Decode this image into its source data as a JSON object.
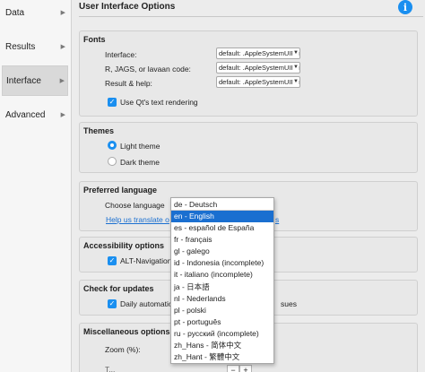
{
  "sidebar": {
    "items": [
      {
        "label": "Data"
      },
      {
        "label": "Results"
      },
      {
        "label": "Interface"
      },
      {
        "label": "Advanced"
      }
    ],
    "active_index": 2
  },
  "page": {
    "title": "User Interface Options",
    "info_icon": "info-icon"
  },
  "fonts": {
    "title": "Fonts",
    "interface_label": "Interface:",
    "interface_value": "default: .AppleSystemUIFont",
    "rjags_label": "R, JAGS, or lavaan code:",
    "rjags_value": "default: .AppleSystemUIFont",
    "result_label": "Result & help:",
    "result_value": "default: .AppleSystemUIFont",
    "qt_rendering_label": "Use Qt's text rendering",
    "qt_rendering_checked": true
  },
  "themes": {
    "title": "Themes",
    "light_label": "Light theme",
    "dark_label": "Dark theme",
    "selected": "light"
  },
  "language": {
    "title": "Preferred language",
    "choose_label": "Choose language",
    "help_link": "Help us translate o",
    "help_link_tail": "s",
    "current": "de - Deutsch",
    "options": [
      "en - English",
      "es - español de España",
      "fr - français",
      "gl - galego",
      "id - Indonesia (incomplete)",
      "it - italiano (incomplete)",
      "ja - 日本語",
      "nl - Nederlands",
      "pl - polski",
      "pt - português",
      "ru - русский (incomplete)",
      "zh_Hans - 简体中文",
      "zh_Hant - 繁體中文"
    ],
    "highlighted_index": 0
  },
  "accessibility": {
    "title": "Accessibility options",
    "alt_nav_label": "ALT-Navigation",
    "alt_nav_checked": true
  },
  "updates": {
    "title": "Check for updates",
    "daily_label": "Daily automatio",
    "daily_tail": "sues",
    "daily_checked": true
  },
  "misc": {
    "title": "Miscellaneous options",
    "zoom_label": "Zoom (%):",
    "partial_label": "T..."
  },
  "colors": {
    "accent": "#1a8ff0",
    "selection": "#1a6fd0",
    "link": "#1a6fd0"
  }
}
